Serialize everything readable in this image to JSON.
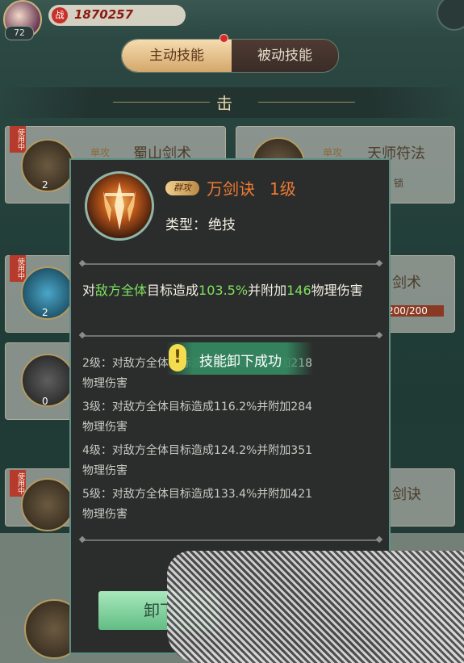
{
  "header": {
    "player_level": "72",
    "power_icon": "战",
    "power_value": "1870257"
  },
  "tabs": {
    "active": "主动技能",
    "inactive": "被动技能"
  },
  "section": {
    "title": "击"
  },
  "background_cards": [
    {
      "tag": "使用中",
      "name": "蜀山剑术",
      "tag2": "单攻",
      "count": "2"
    },
    {
      "name": "天师符法",
      "tag2": "单攻",
      "sub": "锁"
    },
    {
      "tag": "使用中",
      "count": "2",
      "name": "剑术",
      "sub": "200/200"
    },
    {
      "count": "0"
    },
    {
      "tag": "使用中",
      "name": "剑诀"
    }
  ],
  "modal": {
    "tag": "群攻",
    "skill_name": "万剑诀",
    "skill_level": "1级",
    "type_label": "类型：",
    "type_value": "绝技",
    "description": {
      "p1": "对",
      "target": "敌方全体",
      "p2": "目标造成",
      "percent": "103.5%",
      "p3": "并附加",
      "flat": "146",
      "p4": "物理伤害"
    },
    "levels": [
      {
        "line1": "2级：对敌方全体目标造成110.0%并附加218",
        "line2": "物理伤害"
      },
      {
        "line1": "3级：对敌方全体目标造成116.2%并附加284",
        "line2": "物理伤害"
      },
      {
        "line1": "4级：对敌方全体目标造成124.2%并附加351",
        "line2": "物理伤害"
      },
      {
        "line1": "5级：对敌方全体目标造成133.4%并附加421",
        "line2": "物理伤害"
      }
    ],
    "unload_button": "卸下"
  },
  "toast": {
    "icon": "!",
    "text": "技能卸下成功"
  }
}
